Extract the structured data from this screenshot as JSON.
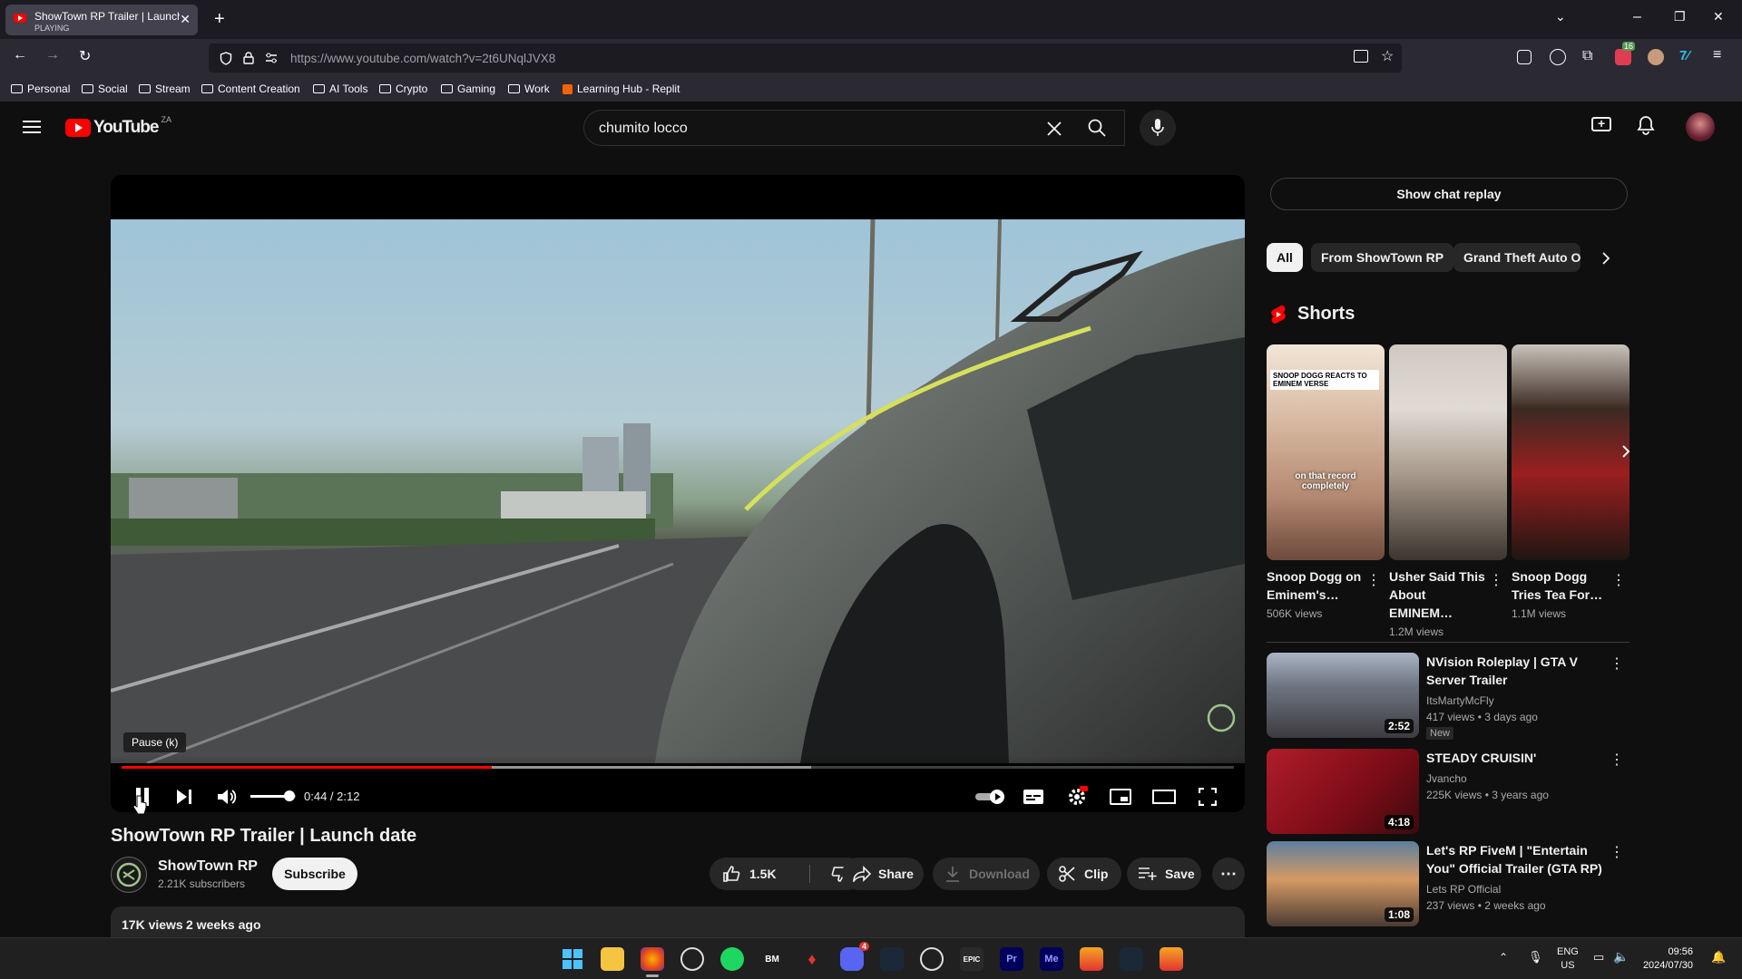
{
  "browser": {
    "tab_title": "ShowTown RP Trailer | Launch d",
    "tab_status": "PLAYING",
    "url": "https://www.youtube.com/watch?v=2t6UNqlJVX8",
    "bookmarks": [
      "Personal",
      "Social",
      "Stream",
      "Content Creation",
      "AI Tools",
      "Crypto",
      "Gaming",
      "Work",
      "Learning Hub - Replit"
    ],
    "ext_badge": "16"
  },
  "header": {
    "logo": "YouTube",
    "region": "ZA",
    "search_value": "chumito locco"
  },
  "player": {
    "tooltip": "Pause (k)",
    "current_time": "0:44",
    "duration": "2:12",
    "time_display": "0:44 / 2:12",
    "progress": 0.333,
    "buffered": 0.62,
    "volume": 0.85
  },
  "video": {
    "title": "ShowTown RP Trailer | Launch date",
    "channel": "ShowTown RP",
    "subscribers": "2.21K subscribers",
    "subscribe_label": "Subscribe",
    "likes": "1.5K",
    "share_label": "Share",
    "download_label": "Download",
    "clip_label": "Clip",
    "save_label": "Save",
    "views": "17K views",
    "age": "2 weeks ago"
  },
  "sidebar": {
    "chat_replay": "Show chat replay",
    "chips": [
      "All",
      "From ShowTown RP",
      "Grand Theft Auto Onl"
    ],
    "shorts_heading": "Shorts",
    "shorts": [
      {
        "title": "Snoop Dogg on Eminem's…",
        "views": "506K views",
        "overlay": "SNOOP DOGG REACTS TO EMINEM VERSE",
        "caption": "on that record completely"
      },
      {
        "title": "Usher Said This About EMINEM…",
        "views": "1.2M views"
      },
      {
        "title": "Snoop Dogg Tries Tea For…",
        "views": "1.1M views"
      }
    ],
    "videos": [
      {
        "title": "NVision Roleplay | GTA V Server Trailer",
        "channel": "ItsMartyMcFly",
        "meta": "417 views • 3 days ago",
        "badge": "New",
        "duration": "2:52"
      },
      {
        "title": "STEADY CRUISIN'",
        "channel": "Jvancho",
        "meta": "225K views • 3 years ago",
        "duration": "4:18"
      },
      {
        "title": "Let's RP FiveM | \"Entertain You\" Official Trailer (GTA RP)",
        "channel": "Lets RP Official",
        "meta": "237 views • 2 weeks ago",
        "duration": "1:08"
      }
    ]
  },
  "taskbar": {
    "lang1": "ENG",
    "lang2": "US",
    "time": "09:56",
    "date": "2024/07/30",
    "discord_badge": "4"
  }
}
